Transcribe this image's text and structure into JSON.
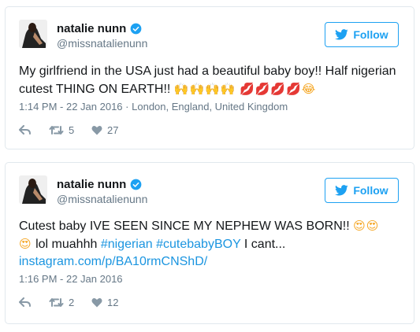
{
  "tweets": [
    {
      "name": "natalie nunn",
      "handle": "@missnatalienunn",
      "follow_label": "Follow",
      "text_line1": "My girlfriend in the USA just had a beautiful baby boy!! Half nigerian",
      "text_line2": "cutest THING ON EARTH!!",
      "emoji_hands": "🙌🙌🙌🙌",
      "emoji_kiss": "💋💋💋💋",
      "emoji_end": "😂",
      "timestamp": "1:14 PM - 22 Jan 2016",
      "location_sep": "·",
      "location": "London, England, United Kingdom",
      "retweets": "5",
      "likes": "27"
    },
    {
      "name": "natalie nunn",
      "handle": "@missnatalienunn",
      "follow_label": "Follow",
      "text_line1": "Cutest baby IVE SEEN SINCE MY NEPHEW WAS BORN!!",
      "emoji_eyes1": "😍😍",
      "emoji_eyes2": "😍",
      "text_line2_a": "lol muahhh",
      "hashtag1": "#nigerian",
      "hashtag2": "#cutebabyBOY",
      "text_line2_b": "I cant...",
      "link": "instagram.com/p/BA10rmCNShD/",
      "timestamp": "1:16 PM - 22 Jan 2016",
      "retweets": "2",
      "likes": "12"
    }
  ],
  "colors": {
    "accent": "#1da1f2",
    "link": "#1b95e0",
    "meta": "#657786",
    "border": "#e1e8ed"
  },
  "icons": [
    "avatar-photo",
    "verified-badge-icon",
    "twitter-bird-icon",
    "reply-icon",
    "retweet-icon",
    "heart-icon"
  ]
}
